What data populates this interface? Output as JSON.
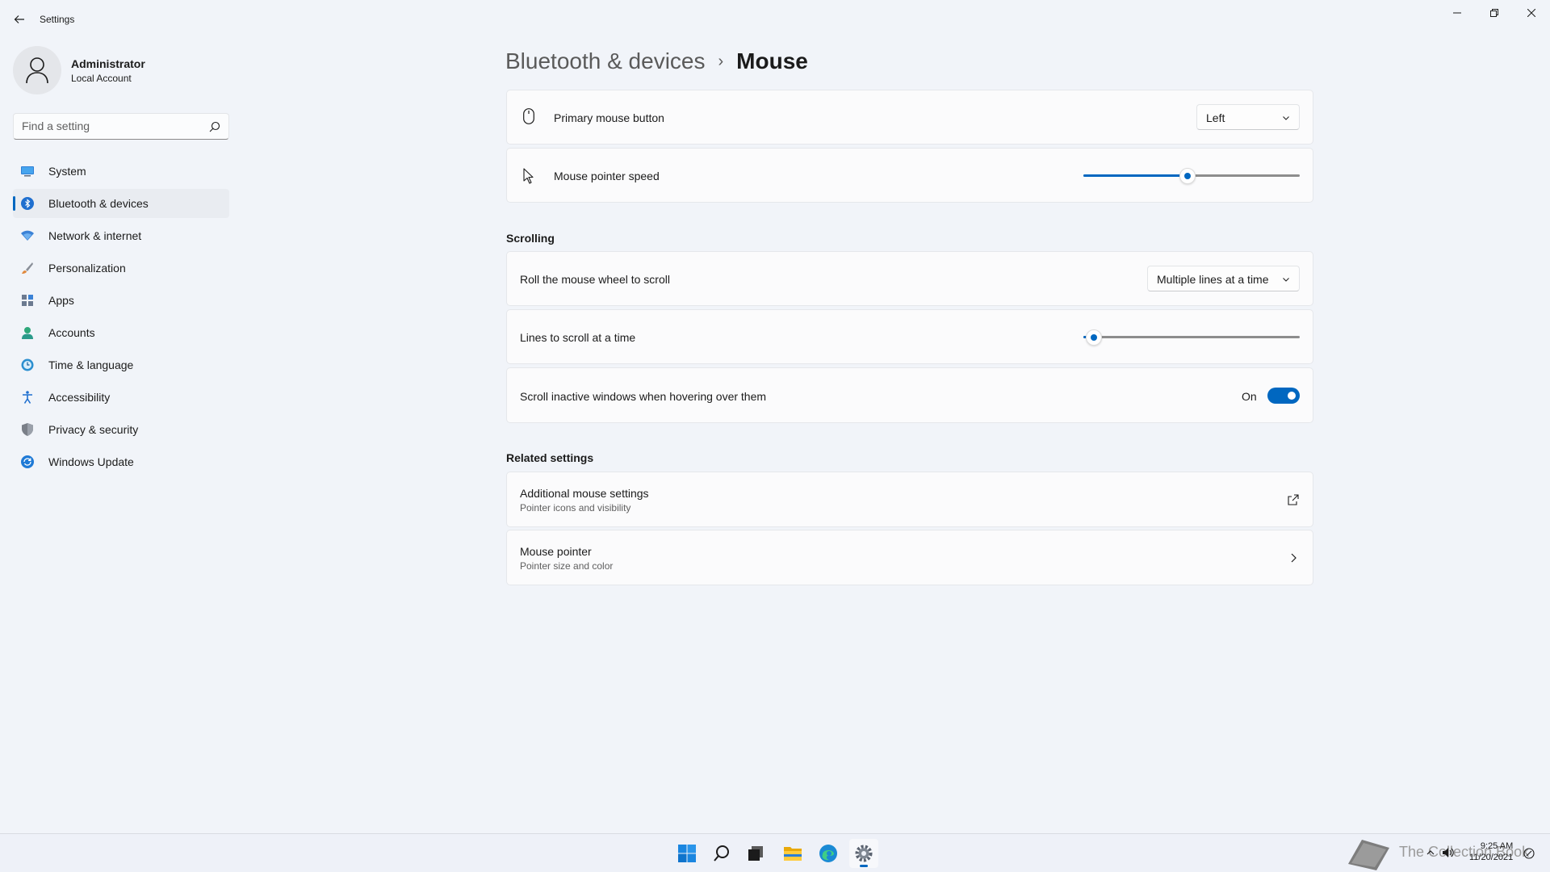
{
  "window": {
    "title": "Settings",
    "controls": {
      "minimize": "minimize-icon",
      "maximize": "restore-icon",
      "close": "close-icon"
    }
  },
  "profile": {
    "name": "Administrator",
    "account_type": "Local Account"
  },
  "search": {
    "placeholder": "Find a setting"
  },
  "nav": {
    "items": [
      {
        "label": "System",
        "icon": "system-icon",
        "color": "#0078d4"
      },
      {
        "label": "Bluetooth & devices",
        "icon": "bluetooth-icon",
        "color": "#0067c0",
        "active": true
      },
      {
        "label": "Network & internet",
        "icon": "network-icon",
        "color": "#3b82d6"
      },
      {
        "label": "Personalization",
        "icon": "brush-icon",
        "color": "#d87a3a"
      },
      {
        "label": "Apps",
        "icon": "apps-icon",
        "color": "#5d6b82"
      },
      {
        "label": "Accounts",
        "icon": "accounts-icon",
        "color": "#2ea77a"
      },
      {
        "label": "Time & language",
        "icon": "time-language-icon",
        "color": "#2b8fd0"
      },
      {
        "label": "Accessibility",
        "icon": "accessibility-icon",
        "color": "#1f6fcf"
      },
      {
        "label": "Privacy & security",
        "icon": "shield-icon",
        "color": "#7a7f88"
      },
      {
        "label": "Windows Update",
        "icon": "update-icon",
        "color": "#1f7ad6"
      }
    ]
  },
  "breadcrumb": {
    "parent": "Bluetooth & devices",
    "separator": "›",
    "current": "Mouse"
  },
  "settings": {
    "primary_button": {
      "label": "Primary mouse button",
      "value": "Left"
    },
    "pointer_speed": {
      "label": "Mouse pointer speed",
      "value_fraction": 0.48
    },
    "scrolling_title": "Scrolling",
    "wheel_scroll": {
      "label": "Roll the mouse wheel to scroll",
      "value": "Multiple lines at a time"
    },
    "lines_to_scroll": {
      "label": "Lines to scroll at a time",
      "value_fraction": 0.05
    },
    "scroll_inactive": {
      "label": "Scroll inactive windows when hovering over them",
      "state": "On"
    },
    "related_title": "Related settings",
    "additional": {
      "label": "Additional mouse settings",
      "sub": "Pointer icons and visibility"
    },
    "mouse_pointer": {
      "label": "Mouse pointer",
      "sub": "Pointer size and color"
    }
  },
  "taskbar": {
    "apps": [
      "start-icon",
      "search-icon",
      "task-view-icon",
      "file-explorer-icon",
      "edge-icon",
      "settings-icon"
    ],
    "watermark": "The Collection Book",
    "time": "9:25 AM",
    "date": "11/20/2021"
  },
  "colors": {
    "accent": "#0067c0",
    "background": "#f1f4f9",
    "card": "#fbfbfc"
  }
}
